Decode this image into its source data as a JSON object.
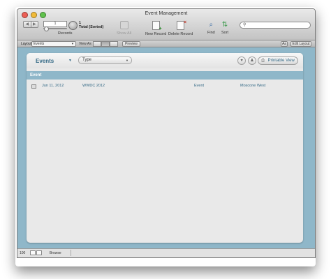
{
  "window": {
    "title": "Event Management"
  },
  "toolbar": {
    "record_field": "1",
    "total_count": "1",
    "total_label": "Total (Sorted)",
    "records_label": "Records",
    "show_all": "Show All",
    "new_record": "New Record",
    "delete_record": "Delete Record",
    "find": "Find",
    "sort": "Sort",
    "search_icon": "search-icon",
    "search_value": ""
  },
  "layout_bar": {
    "layout_label": "Layout",
    "layout_value": "Events",
    "view_as_label": "View As",
    "preview_label": "Preview",
    "aa_label": "Aa",
    "edit_layout_label": "Edit Layout"
  },
  "content": {
    "layout_name": "Events",
    "sort_placeholder": "Type",
    "printable_view": "Printable View",
    "column_header": "Event",
    "rows": [
      {
        "date": "Jun 11, 2012",
        "name": "WWDC 2012",
        "type": "Event",
        "location": "Moscone West"
      }
    ]
  },
  "status_bar": {
    "zoom": "100",
    "mode": "Browse"
  },
  "colors": {
    "accent": "#356a86",
    "panel": "#8fb7c9"
  }
}
